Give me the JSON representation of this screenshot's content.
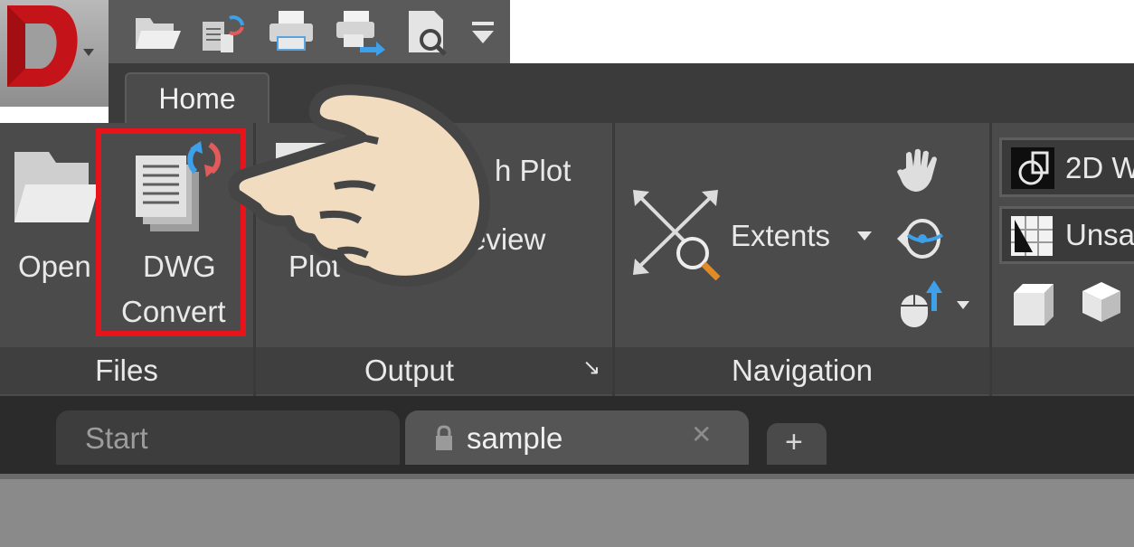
{
  "app": {
    "logo_letter": "D"
  },
  "ribbon_tabs": {
    "home": "Home"
  },
  "files_panel": {
    "open": "Open",
    "dwg_convert_line1": "DWG",
    "dwg_convert_line2": "Convert",
    "title": "Files"
  },
  "output_panel": {
    "plot": "Plot",
    "batch_plot": "h Plot",
    "preview": "eview",
    "title": "Output",
    "launcher_glyph": "↘"
  },
  "navigation_panel": {
    "extents": "Extents",
    "title": "Navigation"
  },
  "view_panel": {
    "visual_style": "2D W",
    "view_state": "Unsav"
  },
  "doc_tabs": {
    "start": "Start",
    "sample": "sample",
    "close_glyph": "✕",
    "add_glyph": "+"
  },
  "icons": [
    "open-folder-icon",
    "convert-icon",
    "print-icon",
    "publish-icon",
    "preview-icon",
    "dropdown-icon",
    "pan-hand-icon",
    "orbit-icon",
    "mouse-icon",
    "cube-icon",
    "pointing-hand-icon",
    "lock-icon"
  ],
  "colors": {
    "highlight": "#e8131b",
    "ribbon_bg": "#4b4b4b",
    "dark_bg": "#3b3b3b",
    "logo_red": "#c4141a",
    "refresh_blue": "#3da0e8",
    "refresh_red": "#e35a5a"
  }
}
